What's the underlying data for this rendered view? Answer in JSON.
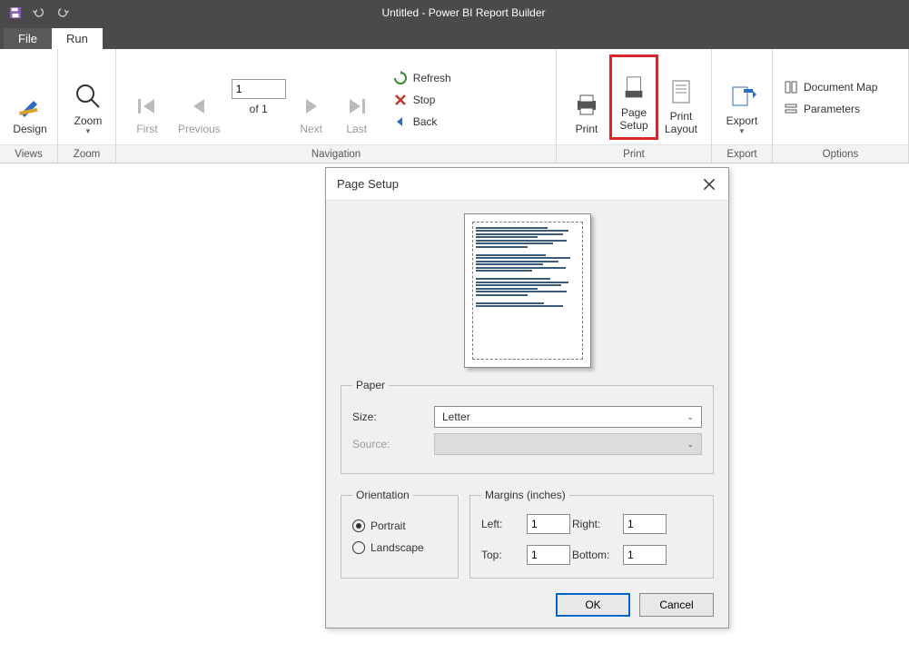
{
  "app": {
    "title": "Untitled - Power BI Report Builder"
  },
  "tabs": {
    "file": "File",
    "run": "Run"
  },
  "ribbon": {
    "views": {
      "label": "Views",
      "design": "Design"
    },
    "zoom": {
      "label": "Zoom",
      "zoom": "Zoom"
    },
    "navigation": {
      "label": "Navigation",
      "first": "First",
      "previous": "Previous",
      "page_value": "1",
      "of_text": "of  1",
      "next": "Next",
      "last": "Last",
      "refresh": "Refresh",
      "stop": "Stop",
      "back": "Back"
    },
    "print_group": {
      "label": "Print",
      "print": "Print",
      "page_setup_line1": "Page",
      "page_setup_line2": "Setup",
      "print_layout_line1": "Print",
      "print_layout_line2": "Layout"
    },
    "export_group": {
      "label": "Export",
      "export": "Export"
    },
    "options": {
      "label": "Options",
      "doc_map": "Document Map",
      "parameters": "Parameters"
    }
  },
  "dialog": {
    "title": "Page Setup",
    "paper": {
      "legend": "Paper",
      "size_label": "Size:",
      "size_value": "Letter",
      "source_label": "Source:"
    },
    "orientation": {
      "legend": "Orientation",
      "portrait": "Portrait",
      "landscape": "Landscape",
      "selected": "portrait"
    },
    "margins": {
      "legend": "Margins (inches)",
      "left_label": "Left:",
      "left_value": "1",
      "right_label": "Right:",
      "right_value": "1",
      "top_label": "Top:",
      "top_value": "1",
      "bottom_label": "Bottom:",
      "bottom_value": "1"
    },
    "buttons": {
      "ok": "OK",
      "cancel": "Cancel"
    }
  }
}
